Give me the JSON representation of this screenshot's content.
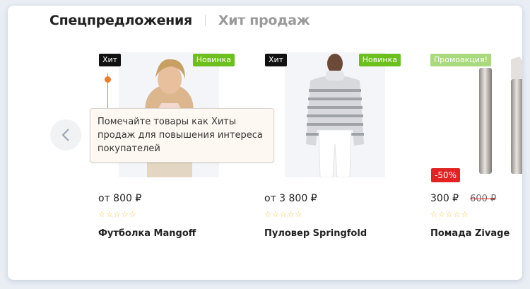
{
  "tabs": [
    {
      "label": "Спецпредложения",
      "active": true
    },
    {
      "label": "Хит продаж",
      "active": false
    }
  ],
  "tooltip": {
    "text": "Помечайте товары как Хиты продаж для повышения интереса покупателей"
  },
  "products": [
    {
      "name": "Футболка Mangoff",
      "price": "от 800 ₽",
      "rating": 0,
      "badges": {
        "left": "Хит",
        "right": "Новинка"
      }
    },
    {
      "name": "Пуловер Springfold",
      "price": "от 3 800 ₽",
      "rating": 0,
      "badges": {
        "left": "Хит",
        "right": "Новинка"
      }
    },
    {
      "name": "Помада Zivage",
      "price": "300 ₽",
      "old_price": "600 ₽",
      "rating": 0,
      "badges": {
        "left": "Промоакция!",
        "discount": "-50%"
      }
    }
  ],
  "icons": {
    "prev": "chevron-left-icon",
    "star": "star-outline-icon"
  },
  "colors": {
    "hit": "#111111",
    "new": "#6cc01e",
    "promo": "#a9d97d",
    "discount": "#e32222",
    "star": "#f5c04a",
    "pointer": "#f07c2a"
  }
}
